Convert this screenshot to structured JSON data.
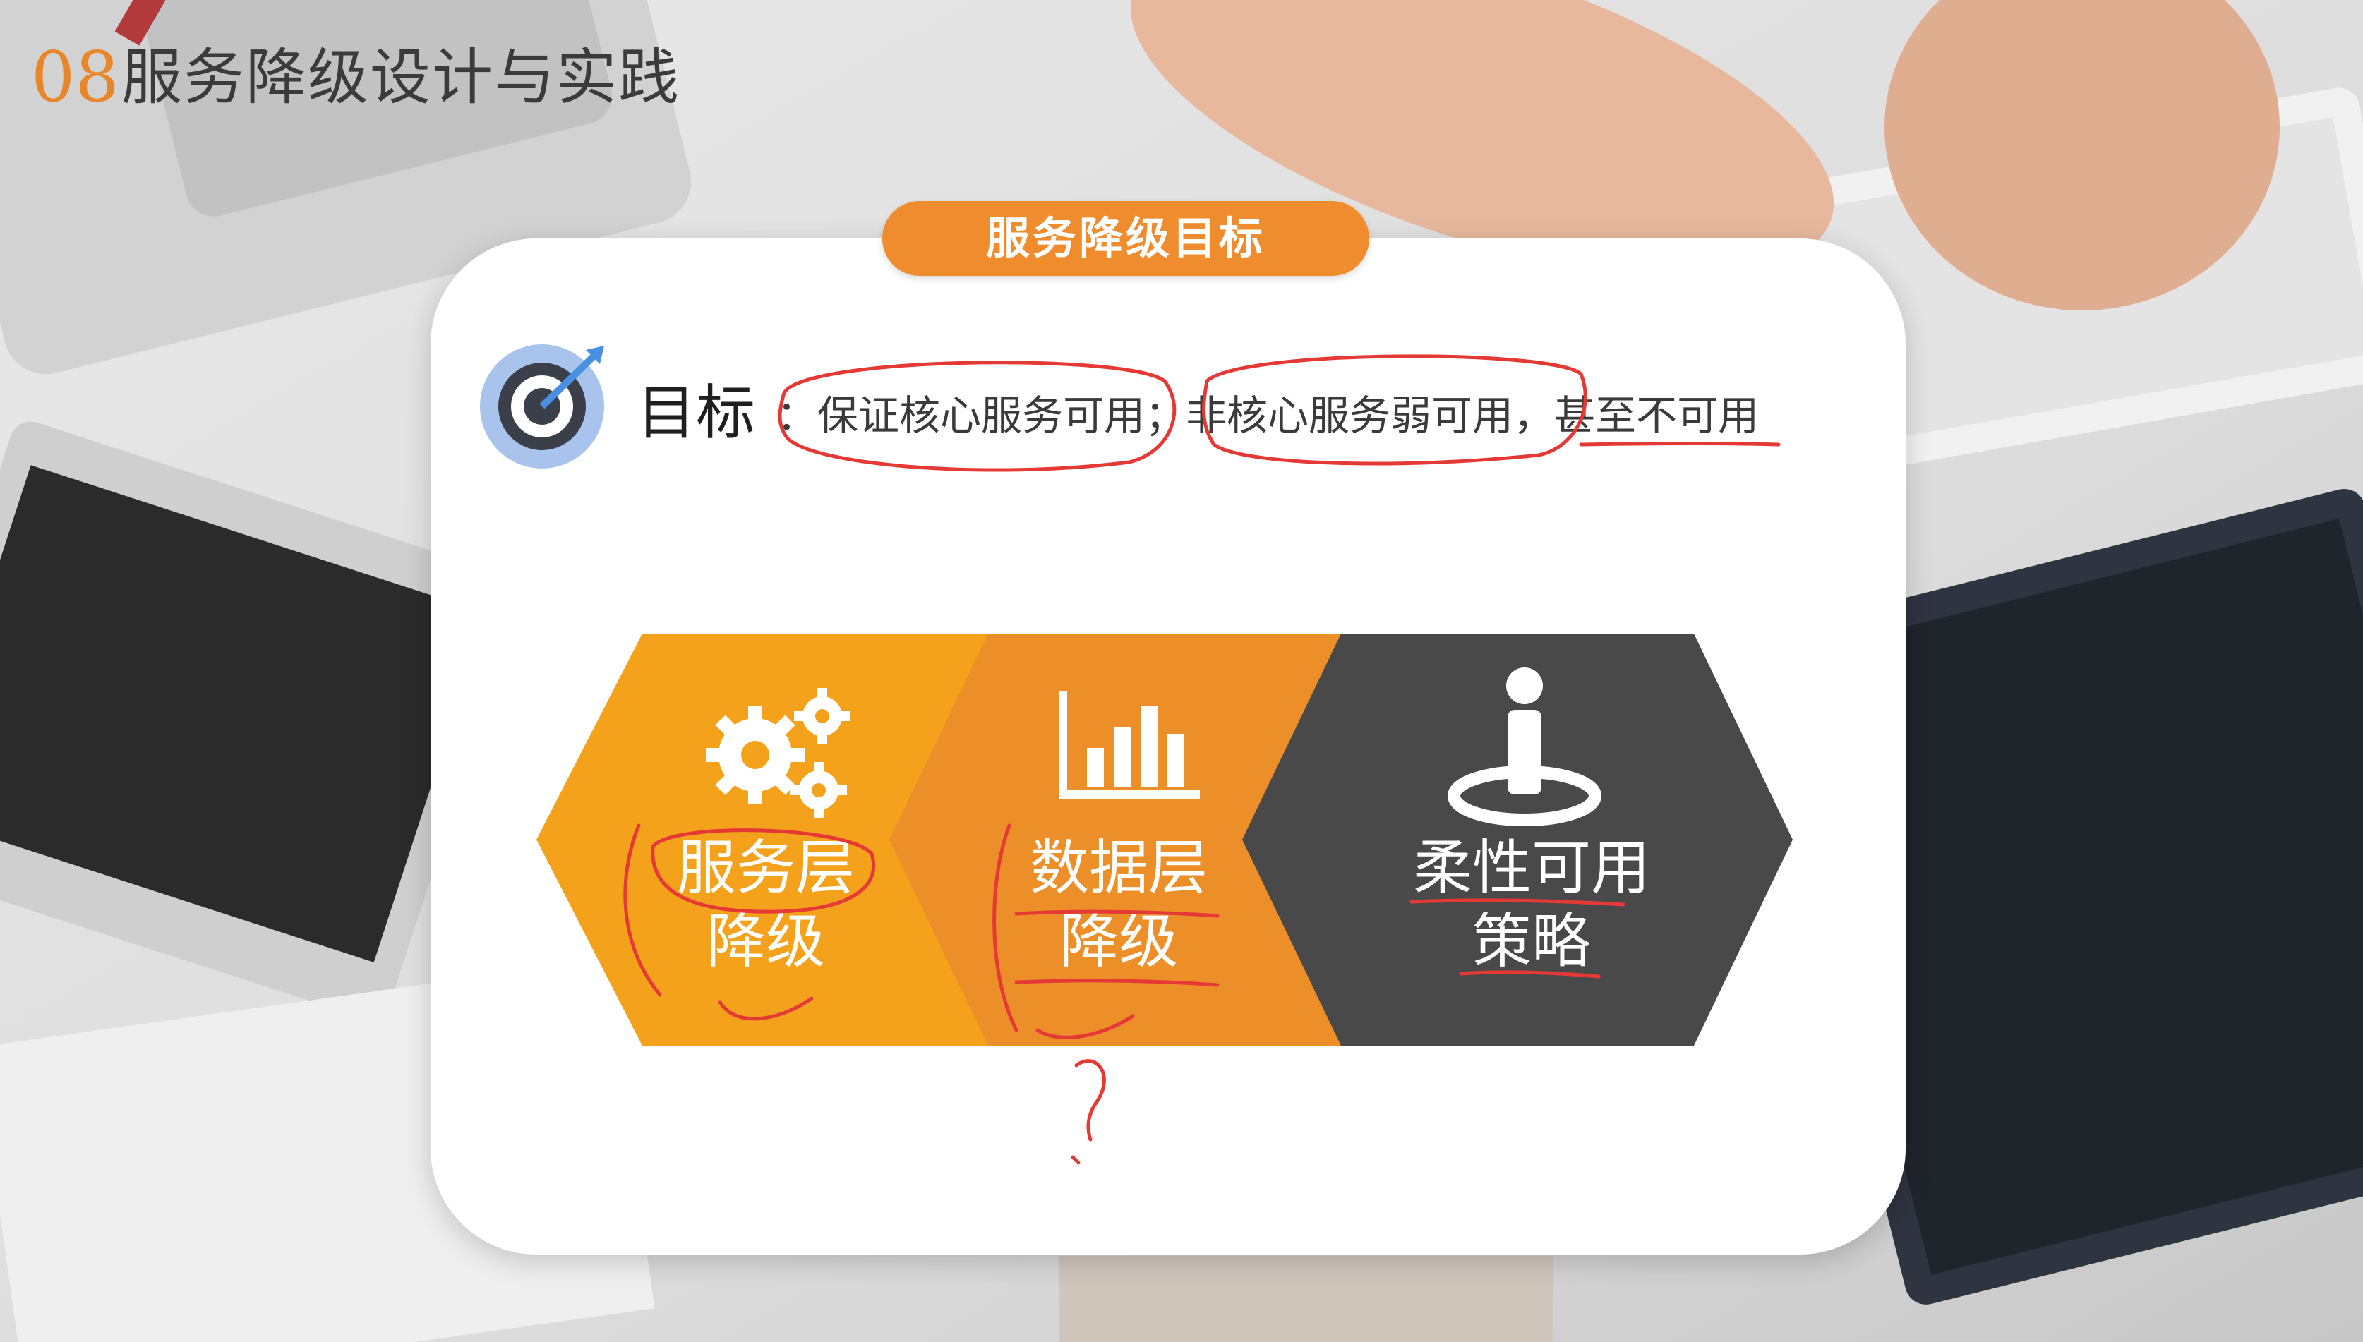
{
  "header": {
    "number": "08",
    "title": "服务降级设计与实践"
  },
  "card": {
    "pill_title": "服务降级目标",
    "goal": {
      "label": "目标",
      "sep1": "：",
      "core": "保证核心服务可用",
      "sep2": "；",
      "noncore": "非核心服务弱可用",
      "sep3": "，",
      "rest": "甚至不可用"
    },
    "hexagons": [
      {
        "line1": "服务层",
        "line2": "降级",
        "icon": "gears-icon",
        "color": "#f4a21c"
      },
      {
        "line1": "数据层",
        "line2": "降级",
        "icon": "bar-chart-icon",
        "color": "#ec8f28"
      },
      {
        "line1": "柔性可用",
        "line2": "策略",
        "icon": "person-target-icon",
        "color": "#494949"
      }
    ]
  },
  "colors": {
    "accent": "#ef8c2d",
    "annotation": "#e53935",
    "dark": "#494949"
  }
}
